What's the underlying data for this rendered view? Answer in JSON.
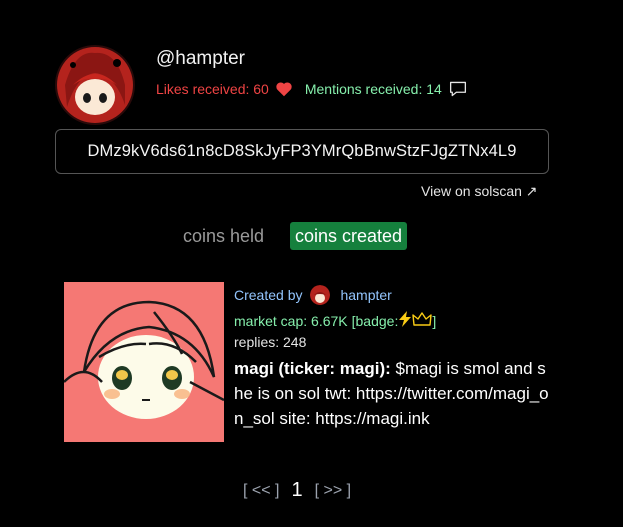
{
  "profile": {
    "username": "@hampter",
    "likes_label": "Likes received: 60",
    "mentions_label": "Mentions received: 14",
    "address": "DMz9kV6ds61n8cD8SkJyFP3YMrQbBnwStzFJgZTNx4L9",
    "solscan_link": "View on solscan ↗"
  },
  "tabs": {
    "held": "coins held",
    "created": "coins created"
  },
  "coin": {
    "created_by_label": "Created by",
    "creator": "hampter",
    "market_cap": "market cap: 6.67K",
    "badge_label": "[badge:",
    "badge_close": "]",
    "replies": "replies: 248",
    "name": "magi (ticker: magi):",
    "description": " $magi is smol and she is on sol twt: https://twitter.com/magi_on_sol site: https://magi.ink"
  },
  "pagination": {
    "prev": "[ << ]",
    "page": "1",
    "next": "[ >> ]"
  },
  "icons": {
    "heart": "heart-icon",
    "comment": "comment-icon",
    "lightning": "lightning-icon",
    "crown": "crown-icon"
  },
  "colors": {
    "likes": "#ef4444",
    "mentions": "#86efac",
    "active_tab": "#15803d",
    "coin_bg": "#f57874"
  }
}
